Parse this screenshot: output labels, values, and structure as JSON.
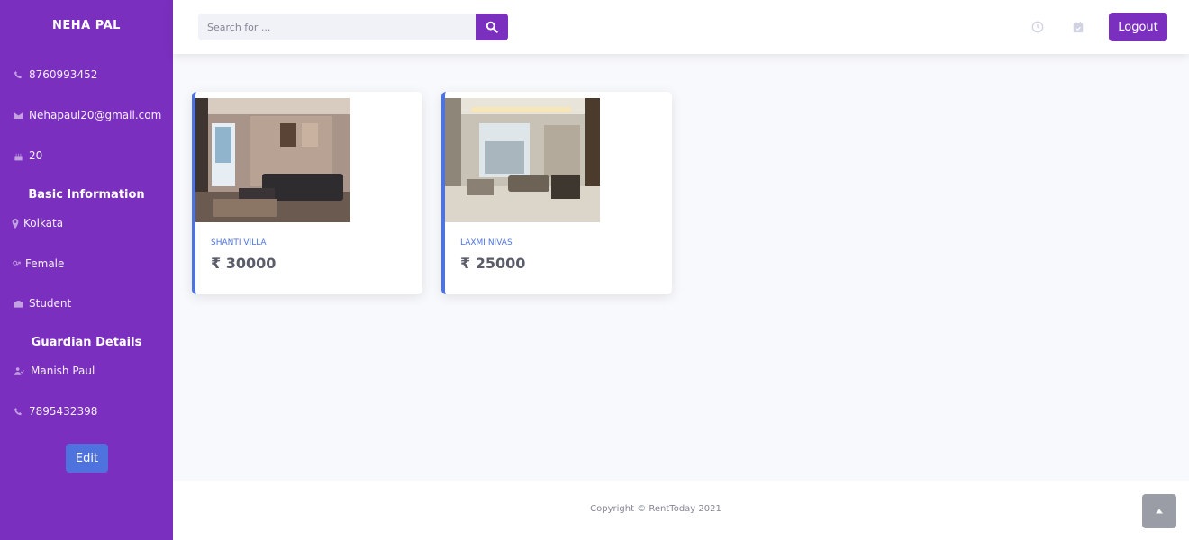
{
  "sidebar": {
    "name": "NEHA PAL",
    "phone": "8760993452",
    "email": "Nehapaul20@gmail.com",
    "age": "20",
    "basic_heading": "Basic Information",
    "city": "Kolkata",
    "gender": "Female",
    "occupation": "Student",
    "guardian_heading": "Guardian Details",
    "guardian_name": "Manish Paul",
    "guardian_phone": "7895432398",
    "edit_label": "Edit"
  },
  "topbar": {
    "search_placeholder": "Search for ...",
    "logout_label": "Logout",
    "icons": [
      "search-icon",
      "history-icon",
      "calendar-icon"
    ]
  },
  "listings": [
    {
      "name": "SHANTI VILLA",
      "price": "₹ 30000"
    },
    {
      "name": "LAXMI NIVAS",
      "price": "₹ 25000"
    }
  ],
  "footer": {
    "copyright": "Copyright © RentToday 2021"
  },
  "colors": {
    "brand": "#7b2fbe",
    "accent": "#4e73df",
    "background": "#f8f9fc"
  }
}
